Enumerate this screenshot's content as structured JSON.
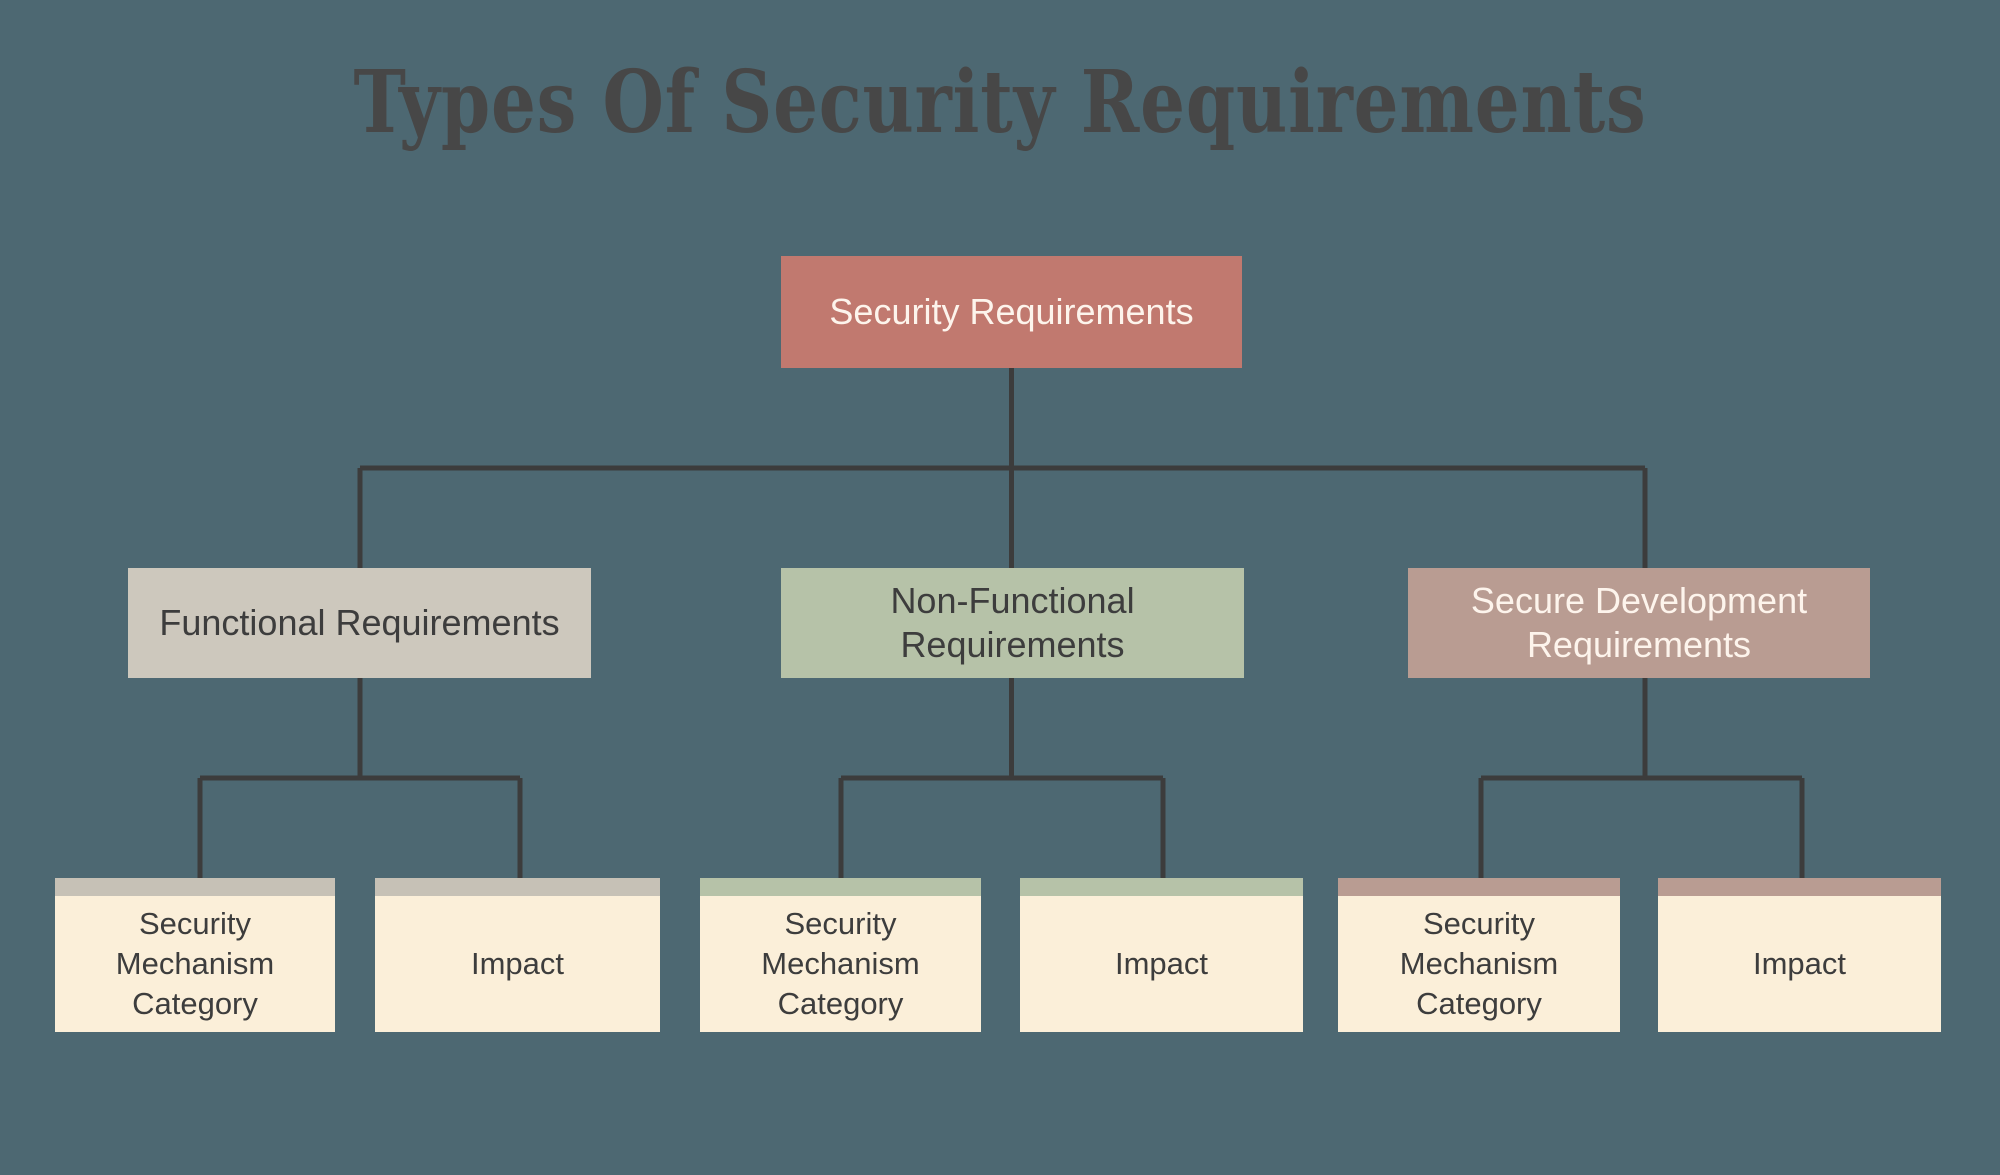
{
  "page": {
    "title": "Types Of Security Requirements",
    "background_color": "#4d6872",
    "title_color": "#474747"
  },
  "diagram": {
    "type": "tree",
    "root": {
      "label": "Security Requirements",
      "fill": "#c1796f",
      "text_color": "#fdf4ec"
    },
    "branches": [
      {
        "label": "Functional Requirements",
        "fill": "#cdc8bd",
        "text_color": "#3d3d3d",
        "accent": "#c6c1b6",
        "children": [
          {
            "label": "Security Mechanism Category"
          },
          {
            "label": "Impact"
          }
        ]
      },
      {
        "label": "Non-Functional Requirements",
        "fill": "#b6c2a8",
        "text_color": "#3d3d3d",
        "accent": "#b6c2a8",
        "children": [
          {
            "label": "Security Mechanism Category"
          },
          {
            "label": "Impact"
          }
        ]
      },
      {
        "label": "Secure Development Requirements",
        "fill": "#b99c92",
        "text_color": "#fdf4ec",
        "accent": "#b99c92",
        "children": [
          {
            "label": "Security Mechanism Category"
          },
          {
            "label": "Impact"
          }
        ]
      }
    ],
    "leaf_fill": "#fbefd9",
    "connector_color": "#3c3c3c"
  }
}
